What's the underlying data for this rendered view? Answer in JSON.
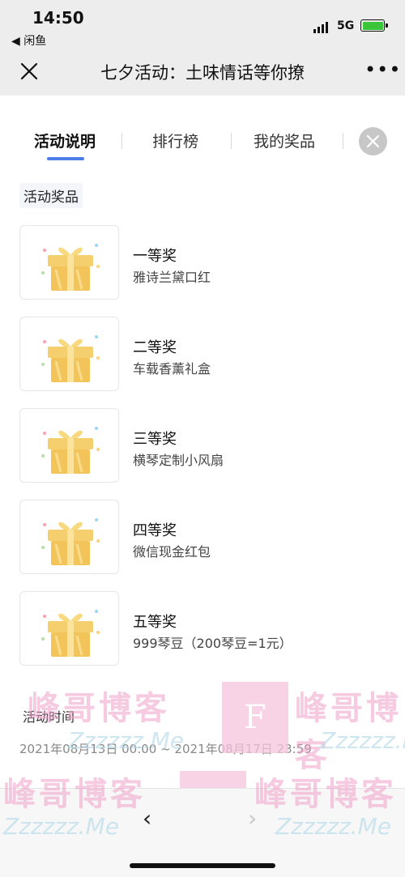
{
  "status_bar": {
    "time": "14:50",
    "back_app": "◀ 闲鱼",
    "network": "5G"
  },
  "nav": {
    "title": "七夕活动：土味情话等你撩",
    "more": "•••"
  },
  "tabs": [
    {
      "label": "活动说明",
      "active": true
    },
    {
      "label": "排行榜",
      "active": false
    },
    {
      "label": "我的奖品",
      "active": false
    }
  ],
  "prizes_section": {
    "label": "活动奖品",
    "items": [
      {
        "rank": "一等奖",
        "name": "雅诗兰黛口红",
        "icon": "gift-box-icon"
      },
      {
        "rank": "二等奖",
        "name": "车载香薰礼盒",
        "icon": "gift-box-icon"
      },
      {
        "rank": "三等奖",
        "name": "横琴定制小风扇",
        "icon": "gift-box-icon"
      },
      {
        "rank": "四等奖",
        "name": "微信现金红包",
        "icon": "gift-box-icon"
      },
      {
        "rank": "五等奖",
        "name": "999琴豆（200琴豆=1元）",
        "icon": "gift-box-icon"
      }
    ]
  },
  "time_section": {
    "label": "活动时间",
    "range": "2021年08月13日 00:00 ~ 2021年08月17日 23:59"
  },
  "watermark": {
    "text": "峰哥博客",
    "sub": "Zzzzzz.Me",
    "logo_letter": "F"
  },
  "browser_nav": {
    "back": "‹",
    "forward": "›"
  },
  "colors": {
    "accent": "#4c7de8",
    "topbar": "#ededed",
    "gift": "#f2c45a"
  }
}
